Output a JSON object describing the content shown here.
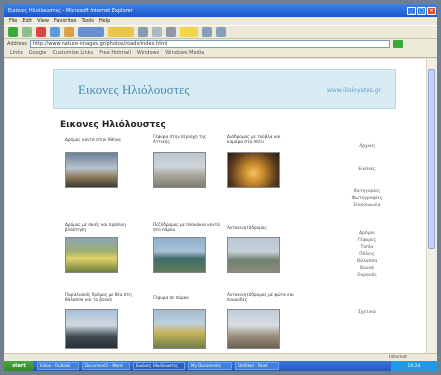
{
  "window": {
    "title": "Εικόνες Ηλιόλουστες - Microsoft Internet Explorer",
    "controls": [
      "_",
      "□",
      "×"
    ]
  },
  "menu": [
    "File",
    "Edit",
    "View",
    "Favorites",
    "Tools",
    "Help"
  ],
  "address": {
    "label": "Address",
    "value": "http://www.nature-images.gr/photos/roads/index.html"
  },
  "links": [
    "Links",
    "Google",
    "Customize Links",
    "Free Hotmail",
    "Windows",
    "Windows Media"
  ],
  "page": {
    "banner_title": "Εικονες Ηλιόλουστες",
    "banner_domain": "www.ilioloystes.gr",
    "heading": "Εικονες Ηλιόλουστες",
    "thumbnails": [
      {
        "caption": "Δρόμος κοντά στην Αθήνα"
      },
      {
        "caption": "Γέφυρα στην περιοχή της Αττικής"
      },
      {
        "caption": "Διάδρομος με τούβλα και καμάρα στο σπίτι"
      },
      {
        "caption": "Δρόμος με σκιές και πράσινη βλάστηση"
      },
      {
        "caption": "Πεζόδρομος με πλακάκια κοντά στο πάρκο"
      },
      {
        "caption": "Αυτοκινητόδρομος"
      },
      {
        "caption": "Παραλιακός δρόμος με θέα στη θάλασσα και το βουνό"
      },
      {
        "caption": "Γέφυρα σε πάρκο"
      },
      {
        "caption": "Αυτοκινητόδρομος με φώτα και πινακίδες"
      }
    ],
    "sidebar_links": [
      "Αρχική",
      "Εικόνες",
      "Κατηγορίες",
      "Φωτογραφίες",
      "Επικοινωνία",
      "Δρόμοι",
      "Γέφυρες",
      "Τοπία",
      "Πόλεις",
      "Θάλασσα",
      "Βουνά",
      "Ουρανός",
      "Σχετικά"
    ]
  },
  "status": {
    "zone": "Internet"
  },
  "taskbar": {
    "start_label": "start",
    "tasks": [
      "Inbox - Outlook",
      "Document1 - Word",
      "Εικόνες Ηλιόλουστες",
      "My Documents",
      "Untitled - Paint"
    ],
    "clock": "10:24"
  }
}
